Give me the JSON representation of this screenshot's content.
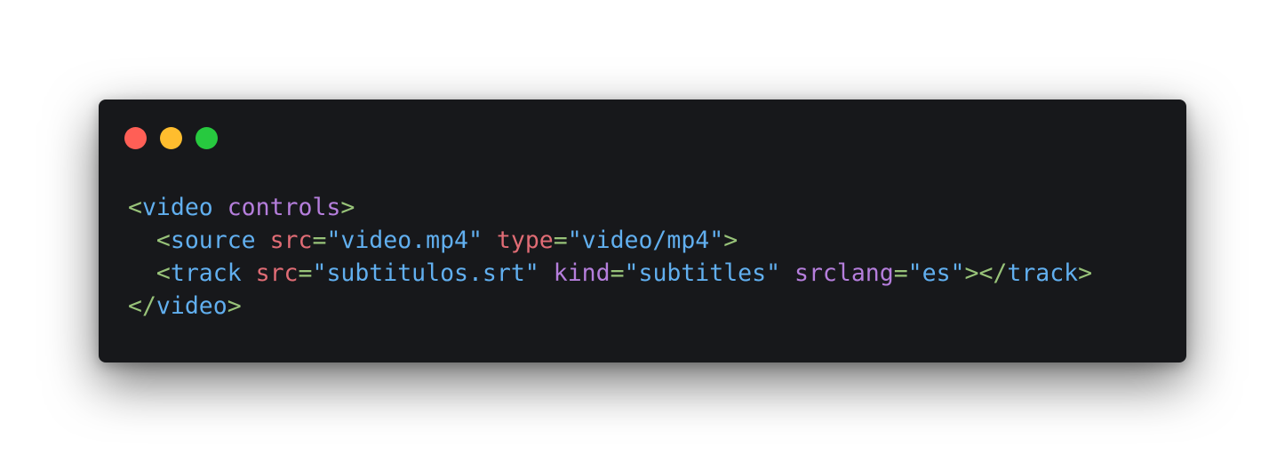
{
  "window": {
    "background": "#17181b",
    "traffic_lights": [
      {
        "name": "close",
        "color": "#ff5f56"
      },
      {
        "name": "minimize",
        "color": "#ffbd2e"
      },
      {
        "name": "zoom",
        "color": "#27c93f"
      }
    ]
  },
  "syntax_colors": {
    "bracket": "#98c379",
    "tag": "#61afef",
    "attr_purple": "#b57edc",
    "attr_red": "#e06c75",
    "equals": "#98c379",
    "string": "#61afef",
    "plain": "#abb2bf"
  },
  "code": {
    "language": "html",
    "lines": [
      [
        {
          "t": "<",
          "c": "bracket"
        },
        {
          "t": "video",
          "c": "tag"
        },
        {
          "t": " ",
          "c": "plain"
        },
        {
          "t": "controls",
          "c": "attr_purple"
        },
        {
          "t": ">",
          "c": "bracket"
        }
      ],
      [
        {
          "t": "  ",
          "c": "plain"
        },
        {
          "t": "<",
          "c": "bracket"
        },
        {
          "t": "source",
          "c": "tag"
        },
        {
          "t": " ",
          "c": "plain"
        },
        {
          "t": "src",
          "c": "attr_red"
        },
        {
          "t": "=",
          "c": "equals"
        },
        {
          "t": "\"video.mp4\"",
          "c": "string"
        },
        {
          "t": " ",
          "c": "plain"
        },
        {
          "t": "type",
          "c": "attr_red"
        },
        {
          "t": "=",
          "c": "equals"
        },
        {
          "t": "\"video/mp4\"",
          "c": "string"
        },
        {
          "t": ">",
          "c": "bracket"
        }
      ],
      [
        {
          "t": "  ",
          "c": "plain"
        },
        {
          "t": "<",
          "c": "bracket"
        },
        {
          "t": "track",
          "c": "tag"
        },
        {
          "t": " ",
          "c": "plain"
        },
        {
          "t": "src",
          "c": "attr_red"
        },
        {
          "t": "=",
          "c": "equals"
        },
        {
          "t": "\"subtitulos.srt\"",
          "c": "string"
        },
        {
          "t": " ",
          "c": "plain"
        },
        {
          "t": "kind",
          "c": "attr_purple"
        },
        {
          "t": "=",
          "c": "equals"
        },
        {
          "t": "\"subtitles\"",
          "c": "string"
        },
        {
          "t": " ",
          "c": "plain"
        },
        {
          "t": "srclang",
          "c": "attr_purple"
        },
        {
          "t": "=",
          "c": "equals"
        },
        {
          "t": "\"es\"",
          "c": "string"
        },
        {
          "t": "></",
          "c": "bracket"
        },
        {
          "t": "track",
          "c": "tag"
        },
        {
          "t": ">",
          "c": "bracket"
        }
      ],
      [
        {
          "t": "</",
          "c": "bracket"
        },
        {
          "t": "video",
          "c": "tag"
        },
        {
          "t": ">",
          "c": "bracket"
        }
      ]
    ]
  }
}
